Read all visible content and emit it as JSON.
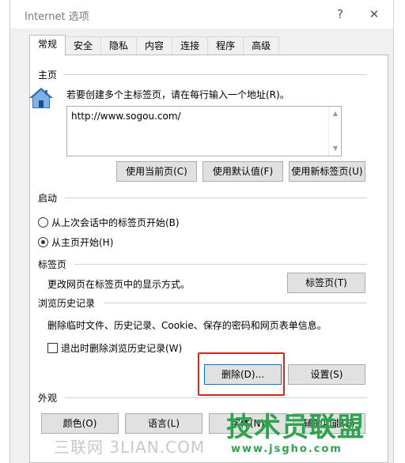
{
  "window": {
    "title": "Internet 选项",
    "help_glyph": "?",
    "close_glyph": "✕"
  },
  "tabs": [
    {
      "label": "常规",
      "active": true
    },
    {
      "label": "安全"
    },
    {
      "label": "隐私"
    },
    {
      "label": "内容"
    },
    {
      "label": "连接"
    },
    {
      "label": "程序"
    },
    {
      "label": "高级"
    }
  ],
  "homepage": {
    "group_label": "主页",
    "description": "若要创建多个主标签页，请在每行输入一个地址(R)。",
    "url": "http://www.sogou.com/",
    "buttons": {
      "use_current": "使用当前页(C)",
      "use_default": "使用默认值(F)",
      "use_new_tab": "使用新标签页(U)"
    }
  },
  "startup": {
    "group_label": "启动",
    "options": [
      {
        "label": "从上次会话中的标签页开始(B)",
        "checked": false
      },
      {
        "label": "从主页开始(H)",
        "checked": true
      }
    ]
  },
  "tabs_section": {
    "group_label": "标签页",
    "description": "更改网页在标签页中的显示方式。",
    "button": "标签页(T)"
  },
  "history": {
    "group_label": "浏览历史记录",
    "description": "删除临时文件、历史记录、Cookie、保存的密码和网页表单信息。",
    "checkbox_label": "退出时删除浏览历史记录(W)",
    "checkbox_checked": false,
    "delete_button": "删除(D)...",
    "settings_button": "设置(S)"
  },
  "appearance": {
    "group_label": "外观",
    "buttons": {
      "colors": "颜色(O)",
      "languages": "语言(L)",
      "fonts": "字体(N)",
      "accessibility": "辅助功能(E)"
    }
  },
  "watermarks": {
    "left": "三联网 3LIAN.COM",
    "right_top": "技术员联盟",
    "right_bottom": "www.jsgho.com"
  },
  "colors": {
    "highlight": "#d9241b",
    "watermark_green": "#2da54e",
    "focus_border": "#0078d7"
  },
  "icons": {
    "homepage": "house-icon"
  }
}
